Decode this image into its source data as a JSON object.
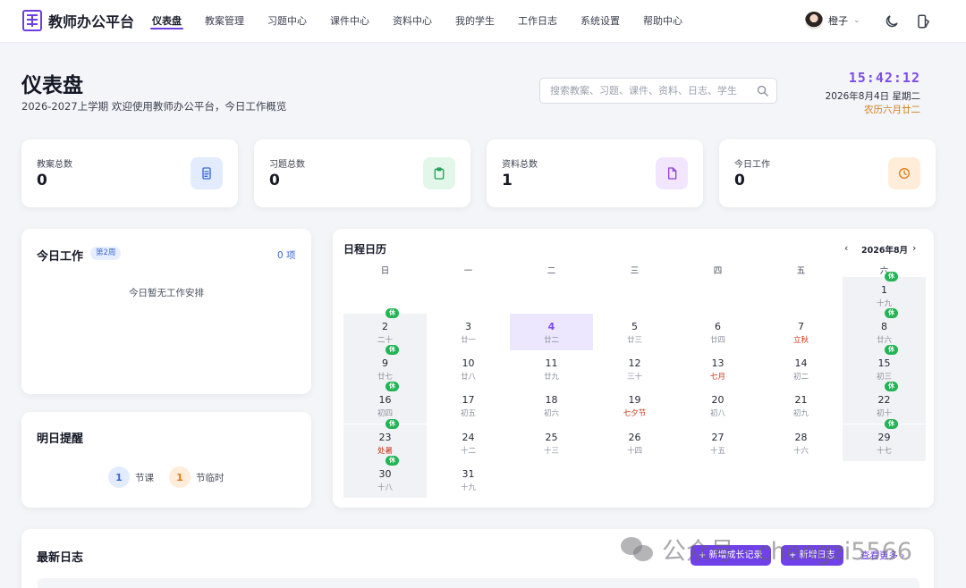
{
  "app": {
    "title": "教师办公平台"
  },
  "nav": {
    "items": [
      {
        "label": "仪表盘",
        "active": true
      },
      {
        "label": "教案管理"
      },
      {
        "label": "习题中心"
      },
      {
        "label": "课件中心"
      },
      {
        "label": "资料中心"
      },
      {
        "label": "我的学生"
      },
      {
        "label": "工作日志"
      },
      {
        "label": "系统设置"
      },
      {
        "label": "帮助中心"
      }
    ]
  },
  "user": {
    "name": "橙子",
    "icons": [
      "moon-icon",
      "theme-icon"
    ]
  },
  "header": {
    "title": "仪表盘",
    "subtitle": "2026-2027上学期 欢迎使用教师办公平台，今日工作概览",
    "search_placeholder": "搜索教案、习题、课件、资料、日志、学生",
    "time": "15:42:12",
    "date": "2026年8月4日 星期二",
    "lunar": "农历六月廿二"
  },
  "stats": [
    {
      "label": "教案总数",
      "value": "0",
      "icon": "document-icon",
      "color": "#3867d6",
      "bg": "#e3ebff"
    },
    {
      "label": "习题总数",
      "value": "0",
      "icon": "clipboard-icon",
      "color": "#22a05a",
      "bg": "#e2f7e9"
    },
    {
      "label": "资料总数",
      "value": "1",
      "icon": "file-icon",
      "color": "#9043d8",
      "bg": "#f2e6ff"
    },
    {
      "label": "今日工作",
      "value": "0",
      "icon": "clock-icon",
      "color": "#e07a16",
      "bg": "#ffecd9"
    }
  ],
  "today": {
    "title": "今日工作",
    "week_badge": "第2周",
    "count": "0 项",
    "empty": "今日暂无工作安排"
  },
  "tomorrow": {
    "title": "明日提醒",
    "items": [
      {
        "value": "1",
        "label": "节课",
        "color": "#3867d6",
        "bg": "#e3ebff"
      },
      {
        "value": "1",
        "label": "节临时",
        "color": "#e07a16",
        "bg": "#ffecd9"
      }
    ]
  },
  "calendar": {
    "title": "日程日历",
    "month": "2026年8月",
    "prev": "‹",
    "next": "›",
    "rest_label": "休",
    "weekdays": [
      "日",
      "一",
      "二",
      "三",
      "四",
      "五",
      "六"
    ],
    "first_weekday": 6,
    "today": 4,
    "days": [
      {
        "n": "1",
        "l": "十九",
        "rest": true
      },
      {
        "n": "2",
        "l": "二十",
        "rest": true
      },
      {
        "n": "3",
        "l": "廿一"
      },
      {
        "n": "4",
        "l": "廿二"
      },
      {
        "n": "5",
        "l": "廿三"
      },
      {
        "n": "6",
        "l": "廿四"
      },
      {
        "n": "7",
        "l": "立秋",
        "festival": true
      },
      {
        "n": "8",
        "l": "廿六",
        "rest": true
      },
      {
        "n": "9",
        "l": "廿七",
        "rest": true
      },
      {
        "n": "10",
        "l": "廿八"
      },
      {
        "n": "11",
        "l": "廿九"
      },
      {
        "n": "12",
        "l": "三十"
      },
      {
        "n": "13",
        "l": "七月",
        "festival": true
      },
      {
        "n": "14",
        "l": "初二"
      },
      {
        "n": "15",
        "l": "初三",
        "rest": true
      },
      {
        "n": "16",
        "l": "初四",
        "rest": true
      },
      {
        "n": "17",
        "l": "初五"
      },
      {
        "n": "18",
        "l": "初六"
      },
      {
        "n": "19",
        "l": "七夕节",
        "festival": true
      },
      {
        "n": "20",
        "l": "初八"
      },
      {
        "n": "21",
        "l": "初九"
      },
      {
        "n": "22",
        "l": "初十",
        "rest": true
      },
      {
        "n": "23",
        "l": "处暑",
        "festival": true,
        "rest": true
      },
      {
        "n": "24",
        "l": "十二"
      },
      {
        "n": "25",
        "l": "十三"
      },
      {
        "n": "26",
        "l": "十四"
      },
      {
        "n": "27",
        "l": "十五"
      },
      {
        "n": "28",
        "l": "十六"
      },
      {
        "n": "29",
        "l": "十七",
        "rest": true
      },
      {
        "n": "30",
        "l": "十八",
        "rest": true
      },
      {
        "n": "31",
        "l": "十九"
      }
    ]
  },
  "logs": {
    "title": "最新日志",
    "add_growth": "+ 新增成长记录",
    "add_log": "+ 新增日志",
    "more": "查看更多 ›"
  },
  "watermark": "公众号 · chengzi5566"
}
